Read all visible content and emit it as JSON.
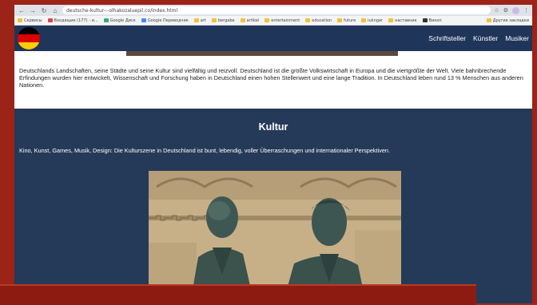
{
  "browser": {
    "url": "deutsche-kultur---olhakozaluepil.co/index.html",
    "bookmarks": [
      "Сервисы",
      "Входящие (177) - и...",
      "Google Диск",
      "Google Переводчик",
      "art",
      "bergabe",
      "artikel",
      "entertainment",
      "education",
      "future",
      "iuknger",
      "наставник",
      "Викоп"
    ],
    "other_bookmarks": "Другие закладки"
  },
  "site": {
    "nav_links": [
      "Schriftsteller",
      "Künstler",
      "Musiker"
    ],
    "flag_colors": [
      "#000000",
      "#dd0000",
      "#ffce00"
    ],
    "intro_text": "Deutschlands Landschaften, seine Städte und seine Kultur sind vielfältig und reizvoll. Deutschland ist die größte Volkswirtschaft in Europa und die viertgrößte der Welt. Viele bahnbrechende Erfindungen wurden hier entwickelt, Wissenschaft und Forschung haben in Deutschland einen hohen Stellenwert und eine lange Tradition. In Deutschland leben rund 13 % Menschen aus anderen Nationen.",
    "kultur_title": "Kultur",
    "kultur_text": "Kino, Kunst, Games, Musik, Design: Die Kulturszene in Deutschland ist bunt, lebendig, voller Überraschungen und internationaler Perspektiven."
  }
}
